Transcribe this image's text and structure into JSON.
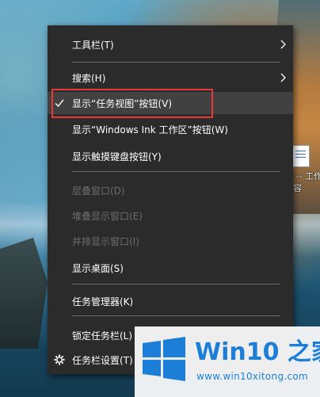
{
  "menu": {
    "items": [
      {
        "label": "工具栏(T)"
      },
      {
        "label": "搜索(H)"
      },
      {
        "label": "显示“任务视图”按钮(V)"
      },
      {
        "label": "显示“Windows Ink 工作区”按钮(W)"
      },
      {
        "label": "显示触摸键盘按钮(Y)"
      },
      {
        "label": "层叠窗口(D)"
      },
      {
        "label": "堆叠显示窗口(E)"
      },
      {
        "label": "并排显示窗口(I)"
      },
      {
        "label": "显示桌面(S)"
      },
      {
        "label": "任务管理器(K)"
      },
      {
        "label": "锁定任务栏(L)"
      },
      {
        "label": "任务栏设置(T)"
      }
    ]
  },
  "desktop": {
    "file_label_line1": "明 -- 工作",
    "file_label_line2": "内容"
  },
  "watermark": {
    "brand_prefix": "Win10",
    "brand_suffix": " 之家",
    "url": "www.win10xitong.com"
  },
  "colors": {
    "menu_bg": "#2b2b2b",
    "menu_hover": "#414141",
    "highlight": "#e8383a",
    "brand_blue": "#1c7ed6"
  }
}
